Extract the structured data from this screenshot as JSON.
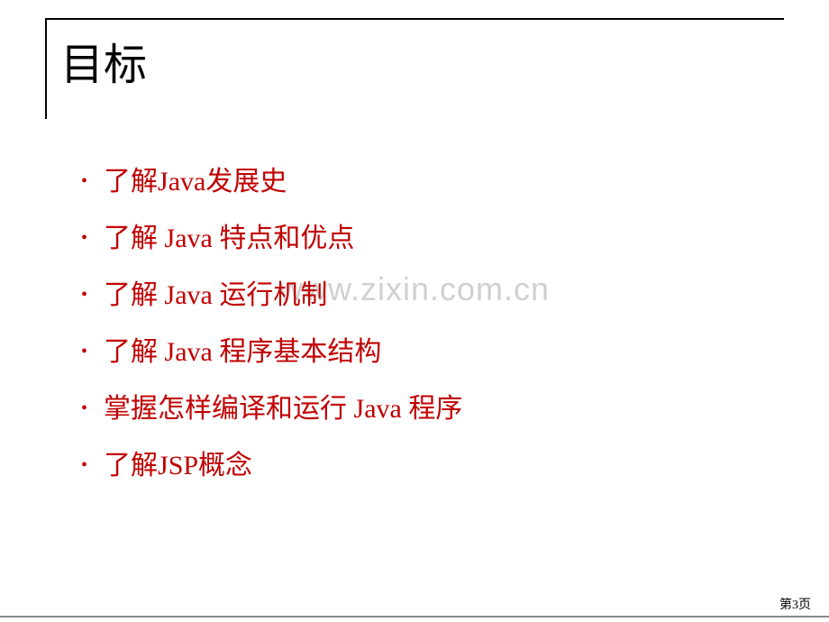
{
  "title": "目标",
  "bullets": [
    "了解Java发展史",
    "了解 Java 特点和优点",
    "了解 Java 运行机制",
    "了解 Java 程序基本结构",
    "掌握怎样编译和运行 Java 程序",
    "了解JSP概念"
  ],
  "watermark": "www.zixin.com.cn",
  "pageNumber": "第3页"
}
